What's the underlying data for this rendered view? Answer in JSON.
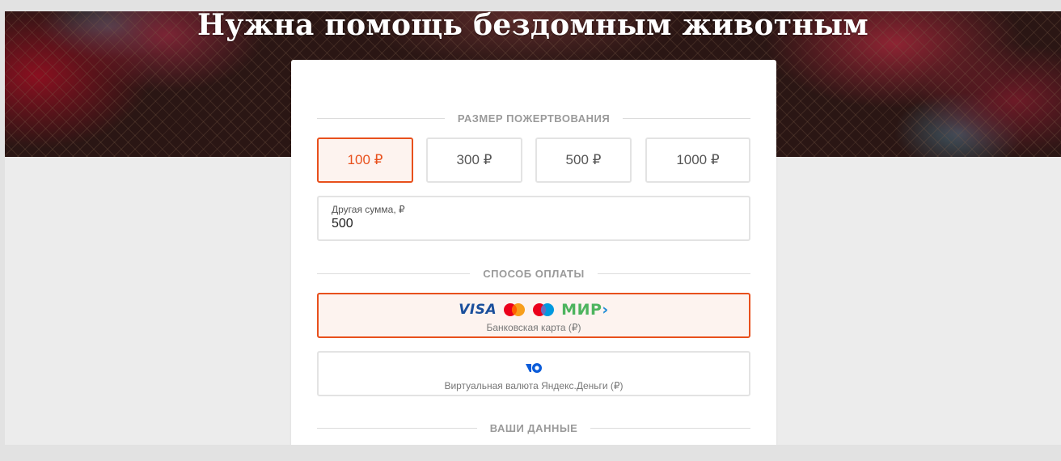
{
  "hero": {
    "title": "Нужна помощь бездомным животным"
  },
  "donation": {
    "section_title": "РАЗМЕР ПОЖЕРТВОВАНИЯ",
    "amounts": [
      {
        "label": "100 ₽",
        "selected": true
      },
      {
        "label": "300 ₽",
        "selected": false
      },
      {
        "label": "500 ₽",
        "selected": false
      },
      {
        "label": "1000 ₽",
        "selected": false
      }
    ],
    "other_amount": {
      "label": "Другая сумма, ₽",
      "value": "500"
    }
  },
  "payment": {
    "section_title": "СПОСОБ ОПЛАТЫ",
    "card": {
      "visa_label": "VISA",
      "mir_label": "МИР",
      "caption": "Банковская карта (₽)",
      "selected": true
    },
    "yandex": {
      "caption": "Виртуальная валюта Яндекс.Деньги (₽)",
      "selected": false
    }
  },
  "user_data": {
    "section_title": "ВАШИ ДАННЫЕ"
  },
  "colors": {
    "accent": "#e8501c",
    "accent_bg": "#fdf3ef",
    "border": "#e3e3e3",
    "section_label": "#9a9a9a",
    "visa_blue": "#1a4f9c",
    "mir_green": "#4db45e",
    "yandex_blue": "#0a5bd9"
  }
}
